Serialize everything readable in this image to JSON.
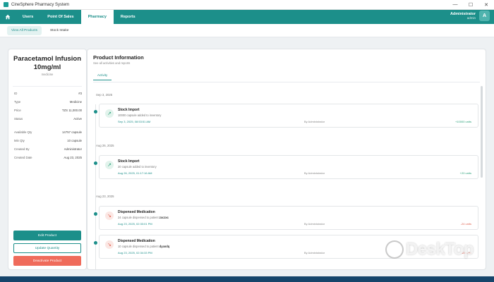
{
  "window": {
    "title": "CineSphere Pharmacy System"
  },
  "window_controls": [
    "—",
    "☐",
    "✕"
  ],
  "nav": {
    "home_icon": "home-icon",
    "tabs": [
      {
        "label": "Users",
        "active": false
      },
      {
        "label": "Point Of Sales",
        "active": false
      },
      {
        "label": "Pharmacy",
        "active": true
      },
      {
        "label": "Reports",
        "active": false
      }
    ],
    "user": {
      "name": "Administrator",
      "role": "admin",
      "avatar": "A"
    }
  },
  "subnav": {
    "tabs": [
      {
        "label": "View All Products",
        "active": true
      },
      {
        "label": "Stock Intake",
        "active": false
      }
    ]
  },
  "product": {
    "name": "Paracetamol Infusion 10mg/ml",
    "type_caption": "medicine",
    "fields": [
      {
        "label": "ID",
        "value": "#3"
      },
      {
        "label": "Type",
        "value": "Medicine"
      },
      {
        "label": "Price",
        "value": "TZS 11,000.00"
      },
      {
        "label": "Status",
        "value": "Active"
      }
    ],
    "fields2": [
      {
        "label": "Available Qty",
        "value": "14757 capsule"
      },
      {
        "label": "Min Qty",
        "value": "10 capsule"
      },
      {
        "label": "Created By",
        "value": "Administrator"
      },
      {
        "label": "Created Date",
        "value": "Aug 23, 2025"
      }
    ],
    "buttons": {
      "edit": "Edit Product",
      "update": "Update Quantity",
      "deactivate": "Deactivate Product"
    }
  },
  "info": {
    "title": "Product Information",
    "subtitle": "See all activities and reports",
    "tab": "Activity"
  },
  "activities": [
    {
      "date": "Sep 3, 2025",
      "title": "Stock Import",
      "desc": "10000 capsule added to inventory",
      "timestamp": "Sep 3, 2025, 08:53:51 AM",
      "by": "By Administrator",
      "amount": "+10000 units",
      "kind": "up"
    },
    {
      "date": "Aug 26, 2025",
      "title": "Stock Import",
      "desc": "20 capsule added to inventory",
      "timestamp": "Aug 26, 2025, 01:17:16 AM",
      "by": "By Administrator",
      "amount": "+20 units",
      "kind": "up"
    },
    {
      "date": "Aug 23, 2025",
      "title": "Dispensed Medication",
      "desc_prefix": "24 capsule dispensed to patient",
      "patient": "zxczxc",
      "timestamp": "Aug 23, 2025, 02:33:01 PM",
      "by": "By Administrator",
      "amount": "-24 units",
      "kind": "down"
    },
    {
      "title": "Dispensed Medication",
      "desc_prefix": "10 capsule dispensed to patient",
      "patient": "dyandq",
      "timestamp": "Aug 23, 2025, 02:34:33 PM",
      "by": "By Administrator",
      "amount": "-10 units",
      "kind": "down"
    }
  ],
  "watermark": "DeskTop",
  "colors": {
    "primary": "#1c8f8a",
    "danger": "#ef6b5b",
    "positive": "#2aa17a"
  }
}
